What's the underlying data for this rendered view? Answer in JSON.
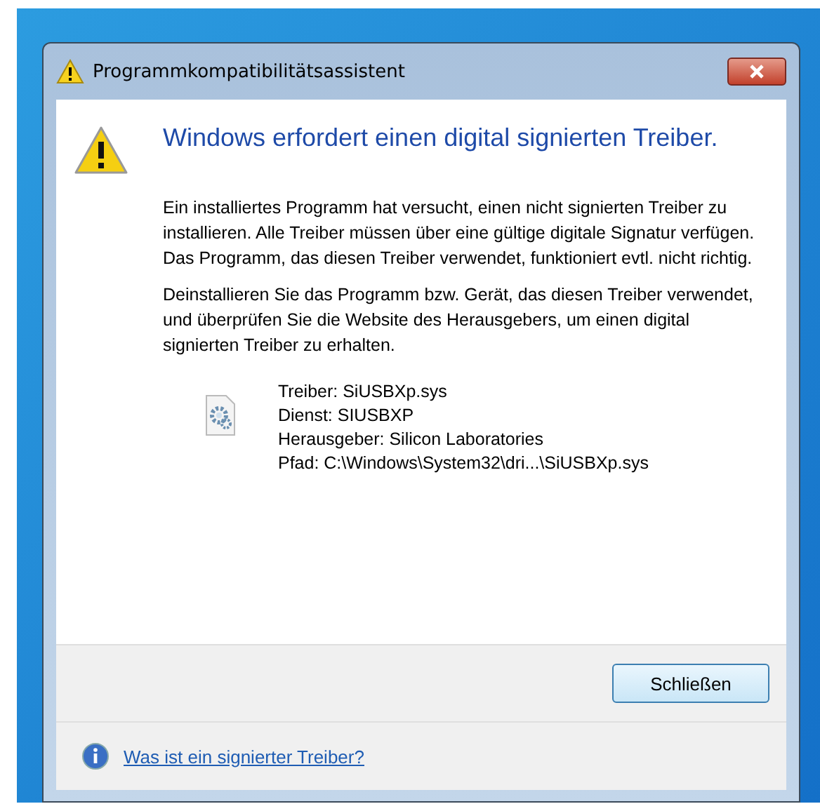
{
  "window": {
    "title": "Programmkompatibilitätsassistent"
  },
  "heading": "Windows erfordert einen digital signierten Treiber.",
  "paragraphs": [
    "Ein installiertes Programm hat versucht, einen nicht signierten Treiber zu installieren. Alle Treiber müssen über eine gültige digitale Signatur verfügen. Das Programm, das diesen Treiber verwendet, funktioniert evtl. nicht richtig.",
    "Deinstallieren Sie das Programm bzw. Gerät, das diesen Treiber verwendet, und überprüfen Sie die Website des Herausgebers, um einen digital signierten Treiber zu erhalten."
  ],
  "details": [
    "Treiber: SiUSBXp.sys",
    "Dienst: SIUSBXP",
    "Herausgeber: Silicon Laboratories",
    "Pfad: C:\\Windows\\System32\\dri...\\SiUSBXp.sys"
  ],
  "buttons": [
    "Schließen"
  ],
  "footer_link": "Was ist ein signierter Treiber?"
}
